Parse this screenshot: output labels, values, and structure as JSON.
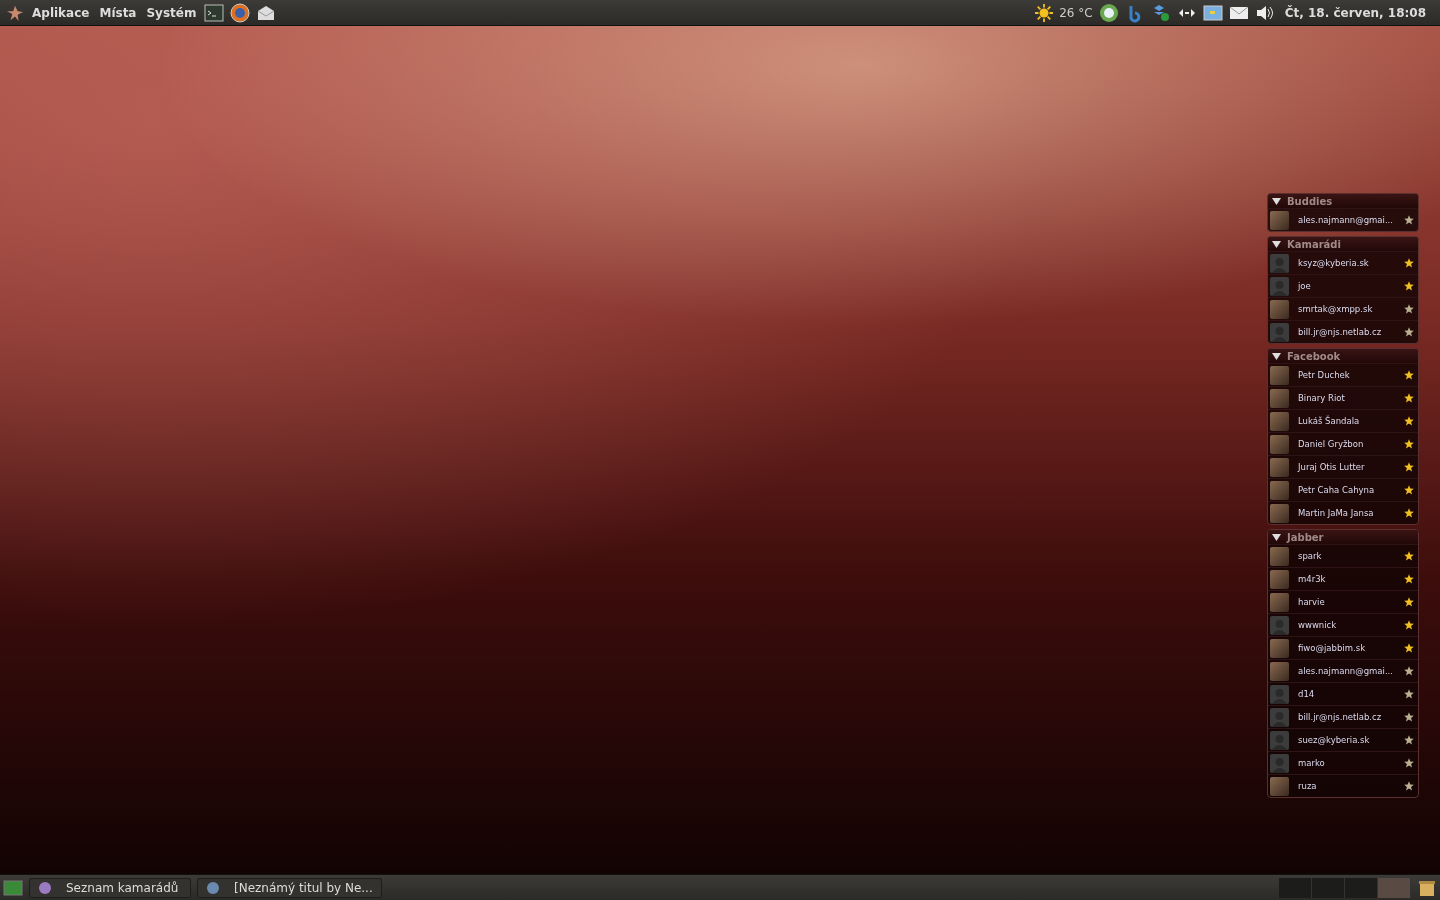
{
  "top_panel": {
    "menus": [
      "Aplikace",
      "Místa",
      "Systém"
    ],
    "weather": "26 °C",
    "clock": "Čt, 18. červen, 18:08"
  },
  "buddy_list": {
    "groups": [
      {
        "name": "Buddies",
        "expanded": true,
        "buddies": [
          {
            "name": "ales.najmann@gmai...",
            "kind": "photo",
            "available": false
          }
        ]
      },
      {
        "name": "Kamarádi",
        "expanded": true,
        "buddies": [
          {
            "name": "ksyz@kyberia.sk",
            "kind": "silhouette",
            "available": true
          },
          {
            "name": "joe",
            "kind": "silhouette",
            "available": true
          },
          {
            "name": "smrtak@xmpp.sk",
            "kind": "photo",
            "available": false
          },
          {
            "name": "bill.jr@njs.netlab.cz",
            "kind": "silhouette",
            "available": false
          }
        ]
      },
      {
        "name": "Facebook",
        "expanded": true,
        "buddies": [
          {
            "name": "Petr Duchek",
            "kind": "photo",
            "available": true
          },
          {
            "name": "Binary Riot",
            "kind": "photo",
            "available": true
          },
          {
            "name": "Lukáš Šandala",
            "kind": "photo",
            "available": true
          },
          {
            "name": "Daniel Gryžbon",
            "kind": "photo",
            "available": true
          },
          {
            "name": "Juraj Otis Lutter",
            "kind": "photo",
            "available": true
          },
          {
            "name": "Petr Caha Cahyna",
            "kind": "photo",
            "available": true
          },
          {
            "name": "Martin JaMa Jansa",
            "kind": "photo",
            "available": true
          }
        ]
      },
      {
        "name": "Jabber",
        "expanded": true,
        "buddies": [
          {
            "name": "spark",
            "kind": "photo",
            "available": true
          },
          {
            "name": "m4r3k",
            "kind": "photo",
            "available": true
          },
          {
            "name": "harvie",
            "kind": "photo",
            "available": true
          },
          {
            "name": "wwwnick",
            "kind": "silhouette",
            "available": true
          },
          {
            "name": "fiwo@jabbim.sk",
            "kind": "photo",
            "available": true
          },
          {
            "name": "ales.najmann@gmai...",
            "kind": "photo",
            "available": false
          },
          {
            "name": "d14",
            "kind": "silhouette",
            "available": false
          },
          {
            "name": "bill.jr@njs.netlab.cz",
            "kind": "silhouette",
            "available": false
          },
          {
            "name": "suez@kyberia.sk",
            "kind": "silhouette",
            "available": false
          },
          {
            "name": "marko",
            "kind": "silhouette",
            "available": false
          },
          {
            "name": "ruza",
            "kind": "photo",
            "available": false
          }
        ]
      }
    ]
  },
  "bottom_panel": {
    "tasks": [
      {
        "label": "Seznam kamarádů"
      },
      {
        "label": "[Neznámý titul by Ne..."
      }
    ],
    "workspaces": [
      {
        "selected": false
      },
      {
        "selected": false
      },
      {
        "selected": false
      },
      {
        "selected": true
      }
    ]
  }
}
